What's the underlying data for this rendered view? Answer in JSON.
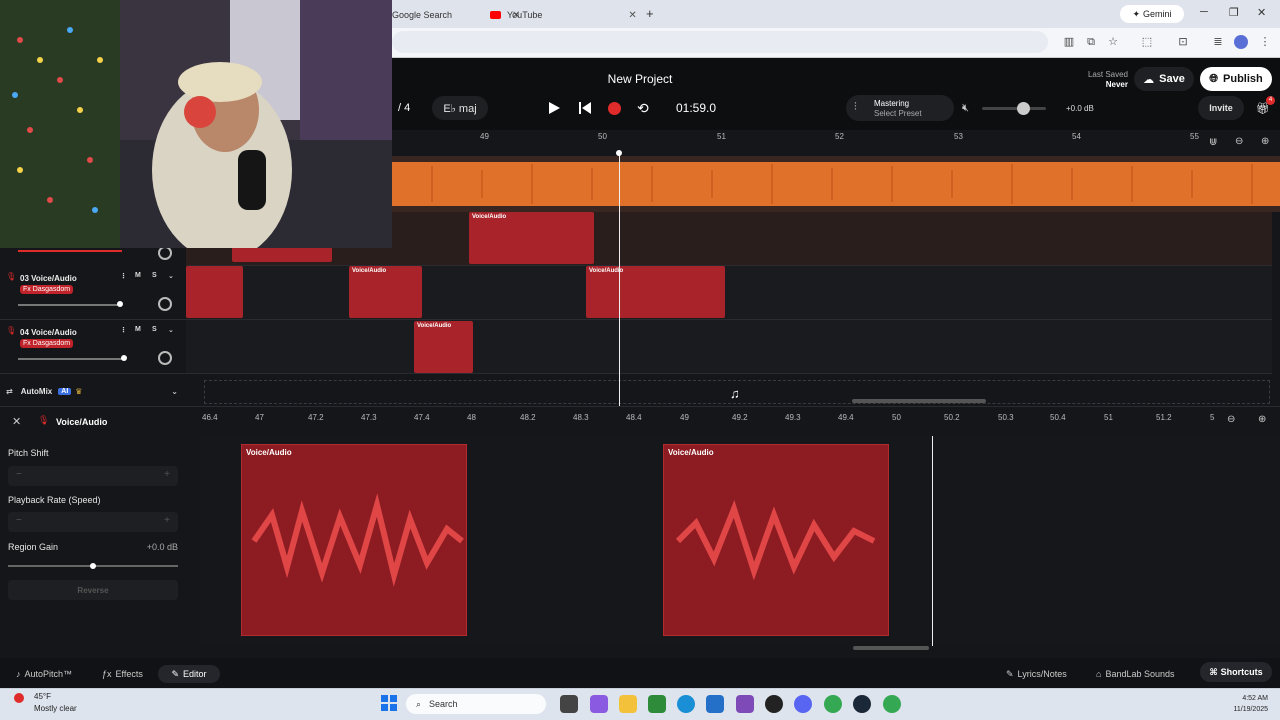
{
  "browser": {
    "tabs": [
      {
        "title": "Google Search"
      },
      {
        "title": "YouTube"
      }
    ],
    "gemini_label": "Gemini"
  },
  "header": {
    "project_title": "New Project",
    "key_label": "E♭ maj",
    "time_signature_partial": "/ 4",
    "time_display": "01:59.0",
    "mastering_label": "Mastering",
    "mastering_preset": "Select Preset",
    "volume_db": "+0.0 dB",
    "last_saved_label": "Last Saved",
    "last_saved_value": "Never",
    "save_label": "Save",
    "publish_label": "Publish",
    "invite_label": "Invite",
    "gift_badge": "4"
  },
  "ruler": {
    "ticks": [
      "49",
      "50",
      "51",
      "52",
      "53",
      "54",
      "55"
    ]
  },
  "tracks": [
    {
      "name": "03 Voice/Audio",
      "fx": "Fx Dasgasdom",
      "mute": "M",
      "solo": "S"
    },
    {
      "name": "04 Voice/Audio",
      "fx": "Fx Dasgasdom",
      "mute": "M",
      "solo": "S"
    }
  ],
  "clip_label": "Voice/Audio",
  "automix": {
    "label": "AutoMix",
    "badge": "AI"
  },
  "editor": {
    "track_name": "Voice/Audio",
    "pitch_shift_label": "Pitch Shift",
    "playback_rate_label": "Playback Rate (Speed)",
    "region_gain_label": "Region Gain",
    "region_gain_value": "+0.0 dB",
    "reverse_label": "Reverse",
    "ruler_ticks": [
      "46.4",
      "47",
      "47.2",
      "47.3",
      "47.4",
      "48",
      "48.2",
      "48.3",
      "48.4",
      "49",
      "49.2",
      "49.3",
      "49.4",
      "50",
      "50.2",
      "50.3",
      "50.4",
      "51",
      "51.2",
      "5"
    ]
  },
  "bottombar": {
    "autopitch": "AutoPitch™",
    "effects": "Effects",
    "editor": "Editor",
    "lyrics": "Lyrics/Notes",
    "sounds": "BandLab Sounds",
    "shortcuts": "Shortcuts"
  },
  "taskbar": {
    "weather_temp": "45°F",
    "weather_desc": "Mostly clear",
    "search_label": "Search",
    "time": "4:52 AM",
    "date": "11/19/2025"
  },
  "colors": {
    "accent_orange": "#f27a2c",
    "clip_red": "#a8242a",
    "record_red": "#e02b2b",
    "background": "#15161a"
  }
}
